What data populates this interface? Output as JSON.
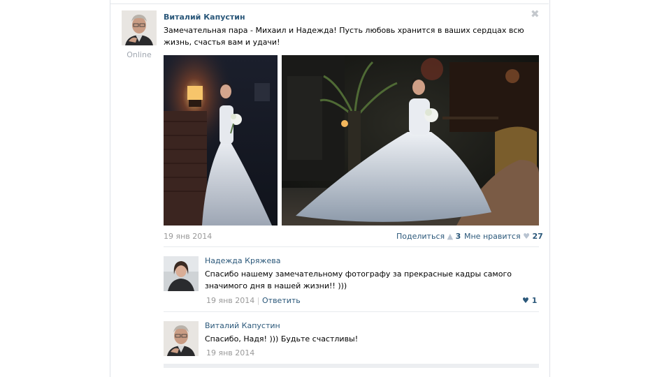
{
  "post": {
    "author": "Виталий Капустин",
    "status": "Online",
    "text": "Замечательная пара - Михаил и Надежда! Пусть любовь хранится в ваших сердцах всю жизнь, счастья вам и удачи!",
    "date": "19 янв 2014",
    "share_label": "Поделиться",
    "share_count": "3",
    "like_label": "Мне нравится",
    "like_count": "27"
  },
  "comments": [
    {
      "author": "Надежда Кряжева",
      "text": "Спасибо нашему замечательному фотографу за прекрасные кадры самого значимого дня в нашей жизни!! )))",
      "date": "19 янв 2014",
      "separator": "|",
      "reply_label": "Ответить",
      "likes": "1"
    },
    {
      "author": "Виталий Капустин",
      "text": "Спасибо, Надя! ))) Будьте счастливы!",
      "date": "19 янв 2014"
    }
  ],
  "icons": {
    "close": "close-icon",
    "share": "megaphone-icon",
    "like": "heart-icon"
  },
  "colors": {
    "link": "#2b587a",
    "muted": "#999999",
    "online": "#a0a7b0"
  }
}
